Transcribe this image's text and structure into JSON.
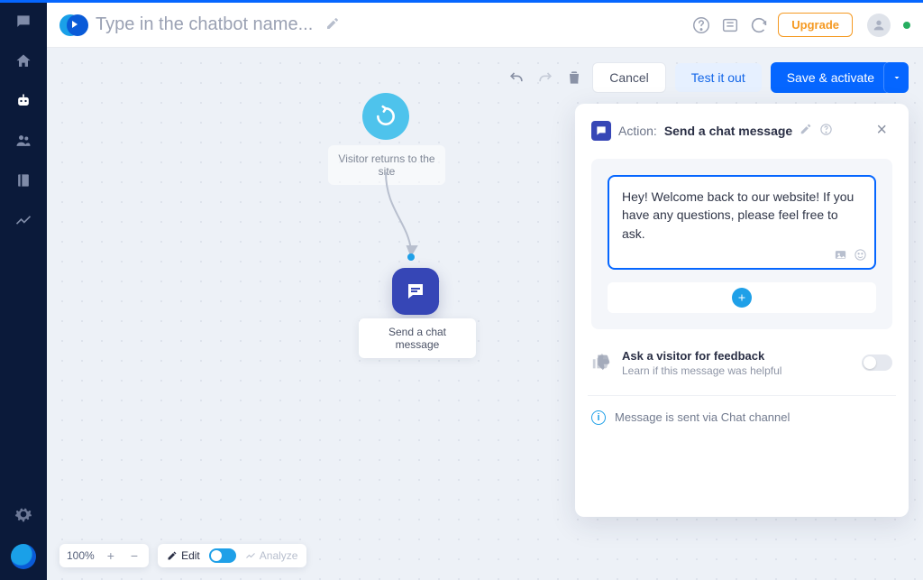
{
  "header": {
    "title_placeholder": "Type in the chatbot name...",
    "upgrade": "Upgrade"
  },
  "toolbar": {
    "cancel": "Cancel",
    "test": "Test it out",
    "save": "Save & activate"
  },
  "flow": {
    "start_label": "Visitor returns to the site",
    "node1_label": "Send a chat message"
  },
  "panel": {
    "prefix": "Action:",
    "title": "Send a chat message",
    "bubble": "Hey! Welcome back to our website! If you have any questions, please feel free to ask.",
    "feedback_title": "Ask a visitor for feedback",
    "feedback_sub": "Learn if this message was helpful",
    "info": "Message is sent via Chat channel"
  },
  "bottombar": {
    "zoom": "100%",
    "edit": "Edit",
    "analyze": "Analyze"
  }
}
